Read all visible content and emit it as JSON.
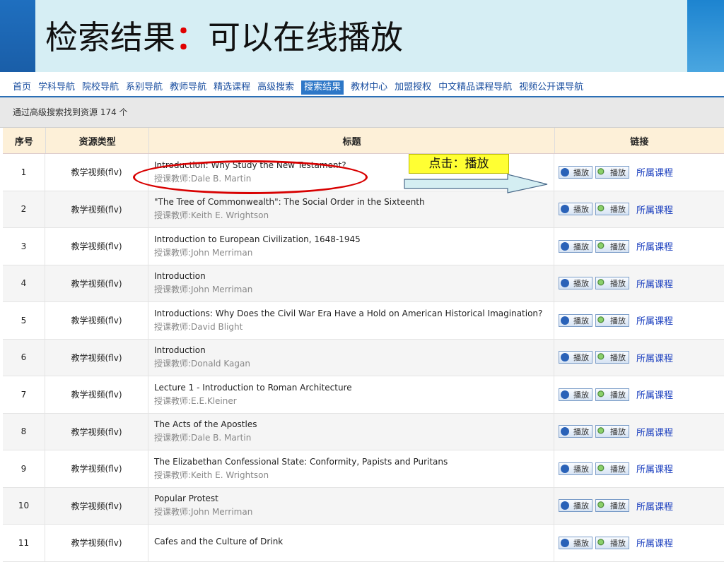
{
  "header": {
    "title_main": "检索结果",
    "title_colon": "：",
    "title_sub": "可以在线播放"
  },
  "nav": [
    {
      "label": "首页"
    },
    {
      "label": "学科导航"
    },
    {
      "label": "院校导航"
    },
    {
      "label": "系别导航"
    },
    {
      "label": "教师导航"
    },
    {
      "label": "精选课程"
    },
    {
      "label": "高级搜索"
    },
    {
      "label": "搜索结果",
      "active": true
    },
    {
      "label": "教材中心"
    },
    {
      "label": "加盟授权"
    },
    {
      "label": "中文精品课程导航"
    },
    {
      "label": "视频公开课导航"
    }
  ],
  "result_summary": "通过高级搜索找到资源 174 个",
  "table": {
    "headers": {
      "idx": "序号",
      "type": "资源类型",
      "title": "标题",
      "link": "链接"
    },
    "play_label": "播放",
    "course_label": "所属课程",
    "rows": [
      {
        "idx": "1",
        "type": "教学视频(flv)",
        "title": "Introduction: Why Study the New Testament?",
        "teacher": "授课教师:Dale B. Martin"
      },
      {
        "idx": "2",
        "type": "教学视频(flv)",
        "title": "\"The Tree of Commonwealth\": The Social Order in the Sixteenth",
        "teacher": "授课教师:Keith E. Wrightson"
      },
      {
        "idx": "3",
        "type": "教学视频(flv)",
        "title": "Introduction to European Civilization, 1648-1945",
        "teacher": "授课教师:John Merriman"
      },
      {
        "idx": "4",
        "type": "教学视频(flv)",
        "title": "Introduction",
        "teacher": "授课教师:John Merriman"
      },
      {
        "idx": "5",
        "type": "教学视频(flv)",
        "title": "Introductions: Why Does the Civil War Era Have a Hold on American Historical Imagination?",
        "teacher": "授课教师:David Blight"
      },
      {
        "idx": "6",
        "type": "教学视频(flv)",
        "title": "Introduction",
        "teacher": "授课教师:Donald Kagan"
      },
      {
        "idx": "7",
        "type": "教学视频(flv)",
        "title": "Lecture 1 - Introduction to Roman Architecture",
        "teacher": "授课教师:E.E.Kleiner"
      },
      {
        "idx": "8",
        "type": "教学视频(flv)",
        "title": "The Acts of the Apostles",
        "teacher": "授课教师:Dale B. Martin"
      },
      {
        "idx": "9",
        "type": "教学视频(flv)",
        "title": "The Elizabethan Confessional State: Conformity, Papists and Puritans",
        "teacher": "授课教师:Keith E. Wrightson"
      },
      {
        "idx": "10",
        "type": "教学视频(flv)",
        "title": "Popular Protest",
        "teacher": "授课教师:John Merriman"
      },
      {
        "idx": "11",
        "type": "教学视频(flv)",
        "title": "Cafes and the Culture of Drink",
        "teacher": ""
      }
    ]
  },
  "annotation": {
    "callout": "点击：播放"
  },
  "colors": {
    "accent": "#2d77c7",
    "annotation_red": "#d80000",
    "callout_bg": "#ffff33"
  }
}
